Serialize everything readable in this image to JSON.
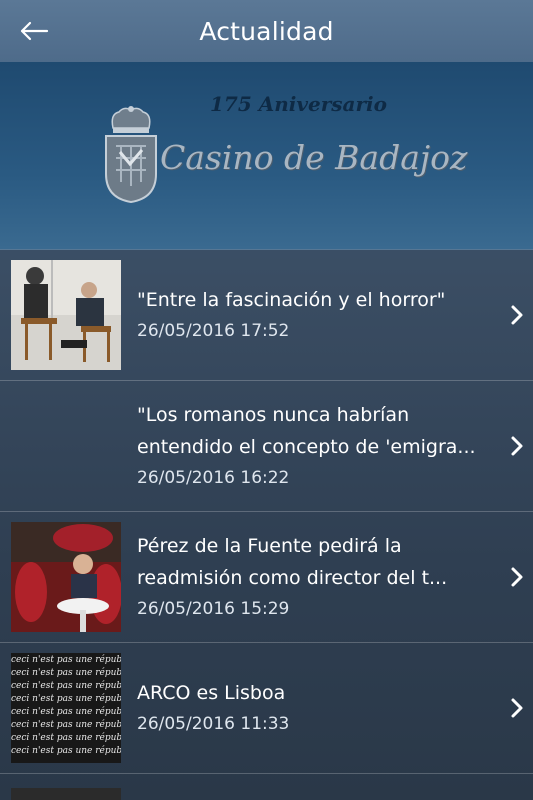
{
  "header": {
    "title": "Actualidad",
    "back_icon": "arrow-left-icon"
  },
  "banner": {
    "anniversary": "175 Aniversario",
    "brand": "Casino de Badajoz",
    "crest_icon": "coat-of-arms-icon"
  },
  "news": [
    {
      "title": "\"Entre la fascinación y el horror\"",
      "date": "26/05/2016 17:52",
      "thumb": "people-seated-photo"
    },
    {
      "title": "\"Los romanos nunca habrían entendido el concepto de 'emigra...",
      "date": "26/05/2016 16:22",
      "thumb": ""
    },
    {
      "title": "Pérez de la Fuente pedirá la readmisión como director del t...",
      "date": "26/05/2016 15:29",
      "thumb": "man-red-chairs-photo"
    },
    {
      "title": "ARCO es Lisboa",
      "date": "26/05/2016 11:33",
      "thumb": "handwriting-text-photo"
    }
  ],
  "handwriting": "ceci n'est pas une république"
}
